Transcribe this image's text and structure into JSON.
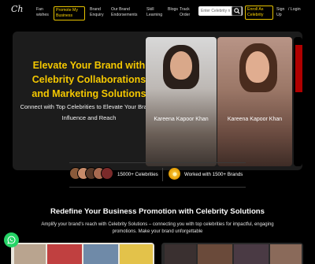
{
  "nav": {
    "logo": "Ch",
    "items": [
      "Fan wishes",
      "Promote My Business",
      "Brand Enquiry",
      "Our Brand Endorsements",
      "Skill Learning",
      "Blogs",
      "Track Order",
      "Enroll As Celebrity",
      "Sign Up",
      "/ Login"
    ],
    "search_placeholder": "Enter Celebrity n"
  },
  "hero": {
    "title": "Elevate Your Brand with Celebrity Collaborations and Marketing Solutions",
    "subtitle": "Connect with Top Celebrities to Elevate Your Brand’s Influence and Reach",
    "videos": [
      {
        "label": "Kareena Kapoor Khan"
      },
      {
        "label": "Kareena Kapoor Khan"
      }
    ]
  },
  "stats": {
    "celebrities": "15000+ Celebrities",
    "brands": "Worked with 1500+ Brands"
  },
  "section": {
    "title": "Redefine Your Business Promotion with Celebrity Solutions",
    "text": "Amplify your brand's reach with Celebrity Solutions – connecting you with top celebrities for impactful, engaging promotions. Make your brand unforgettable"
  },
  "colors": {
    "accent": "#f5c800",
    "whatsapp": "#25d366"
  }
}
